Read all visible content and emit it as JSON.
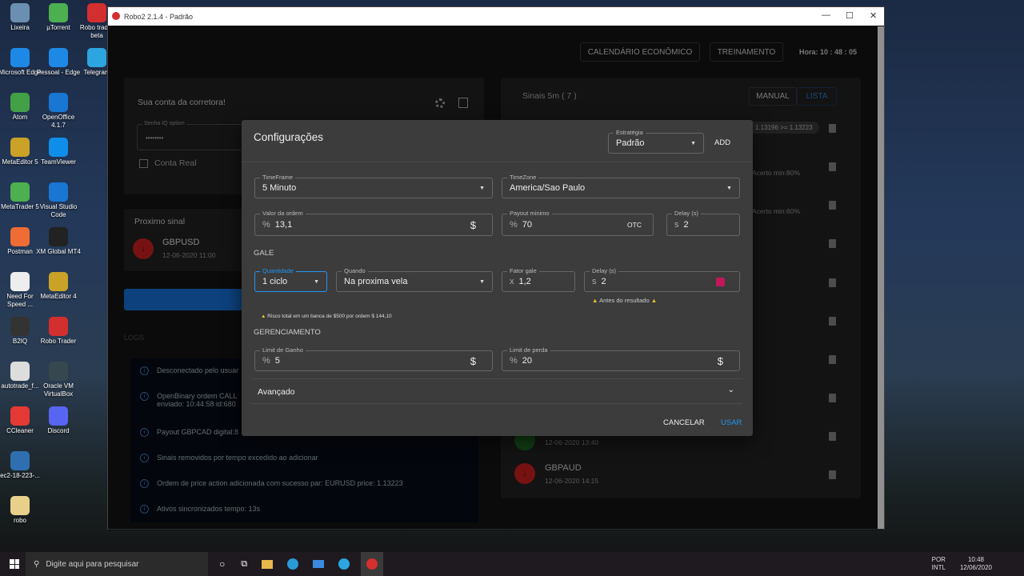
{
  "desktop": {
    "icons": [
      "Lixeira",
      "µTorrent",
      "Robo trader beta",
      "Microsoft Edge",
      "Pessoal - Edge",
      "Telegram",
      "Atom",
      "OpenOffice 4.1.7",
      "MetaEditor 5",
      "TeamViewer",
      "MetaTrader 5",
      "Visual Studio Code",
      "Postman",
      "XM Global MT4",
      "Need For Speed ...",
      "MetaEditor 4",
      "B2IQ",
      "Robo Trader",
      "autotrade_f...",
      "Oracle VM VirtualBox",
      "CCleaner",
      "Discord",
      "ec2-18-223-...",
      "robo"
    ]
  },
  "window": {
    "title": "Robo2 2.1.4 - Padrão",
    "minimize": "—",
    "maximize": "☐",
    "close": "✕"
  },
  "header": {
    "calendar": "CALENDÁRIO ECONÔMICO",
    "training": "TREINAMENTO",
    "clock": "Hora: 10 : 48 : 05"
  },
  "account": {
    "title": "Sua conta da corretora!",
    "password_label": "Senha IQ option",
    "password_value": "••••••••",
    "real_label": "Conta Real"
  },
  "next_signal": {
    "title": "Proximo sinal",
    "pair": "GBPUSD",
    "time": "12-06-2020 11:00"
  },
  "logs": {
    "title": "LOGS",
    "items": [
      "Desconectado pelo usuar",
      "OpenBinary ordem CALL",
      "Payout GBPCAD digital:8",
      "Sinais removidos por tempo excedido ao adicionar",
      "Ordem de price action adicionada com sucesso par: EURUSD price: 1.13223",
      "Ativos sincronizados tempo: 13s"
    ],
    "item2_line2": "enviado: 10:44:58 id:680"
  },
  "signals": {
    "title": "Sinais 5m ( 7 )",
    "manual": "MANUAL",
    "lista": "LISTA",
    "chip": "1.13196 >= 1.13223",
    "acerto1": "Acerto min:80%",
    "acerto2": "Acerto min:60%",
    "items": [
      {
        "pair": "",
        "time": "12-06-2020 13:40",
        "dir": "up"
      },
      {
        "pair": "GBPAUD",
        "time": "12-06-2020 14:15",
        "dir": "down"
      }
    ]
  },
  "modal": {
    "title": "Configurações",
    "strategy_label": "Estratégia",
    "strategy": "Padrão",
    "add": "ADD",
    "timeframe_label": "TimeFrame",
    "timeframe": "5 Minuto",
    "timezone_label": "TimeZone",
    "timezone": "America/Sao Paulo",
    "order_label": "Valor da ordem",
    "order": "13,1",
    "order_prefix": "%",
    "payout_label": "Payout minimo",
    "payout": "70",
    "otc": "OTC",
    "delay_label": "Delay (s)",
    "delay": "2",
    "s_prefix": "s",
    "gale": "GALE",
    "qty_label": "Quantidade",
    "qty": "1 ciclo",
    "when_label": "Quando",
    "when": "Na proxima vela",
    "factor_label": "Fator gale",
    "factor": "1,2",
    "x_prefix": "x",
    "gdelay_label": "Delay (s)",
    "gdelay": "2",
    "before": "Antes do resultado",
    "risk": "Risco total em um banca de $500 por ordem $ 144,10",
    "mgmt": "GERENCIAMENTO",
    "gain_label": "Limit de Ganho",
    "gain": "5",
    "loss_label": "Limit de perda",
    "loss": "20",
    "dollar": "$",
    "advanced": "Avançado",
    "cancel": "CANCELAR",
    "use": "USAR"
  },
  "taskbar": {
    "search": "Digite aqui para pesquisar",
    "lang1": "POR",
    "lang2": "INTL",
    "time": "10:48",
    "date": "12/06/2020"
  },
  "colors": {
    "accent": "#2196f3",
    "danger": "#c2185b",
    "down": "#b71c1c",
    "up": "#1b5e20"
  }
}
